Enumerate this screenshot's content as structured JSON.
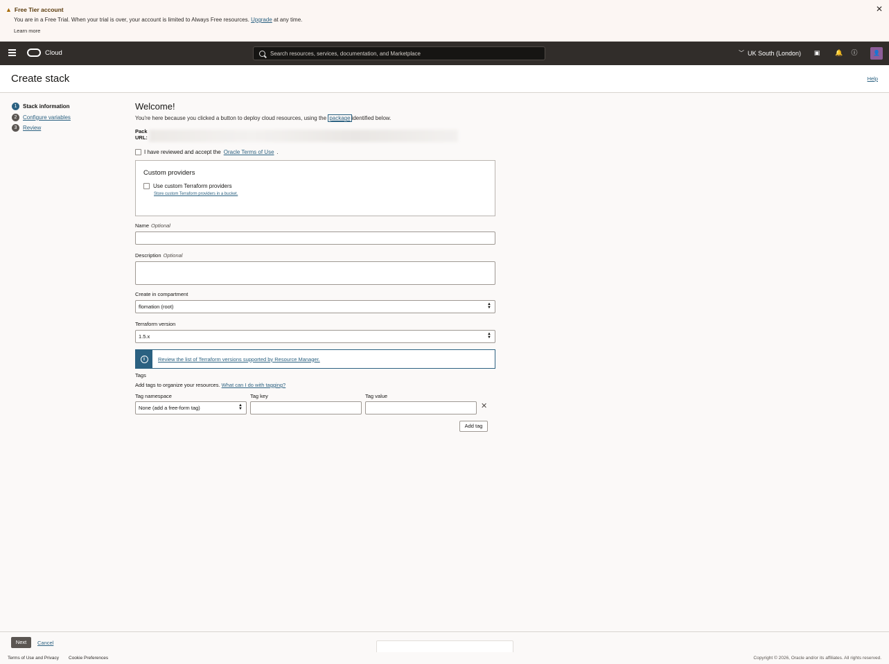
{
  "banner": {
    "title": "Free Tier account",
    "text_before": "You are in a Free Trial. When your trial is over, your account is limited to Always Free resources.",
    "upgrade_link": "Upgrade",
    "text_after": "at any time.",
    "learn_more": "Learn more"
  },
  "header": {
    "brand": "Cloud",
    "search_placeholder": "Search resources, services, documentation, and Marketplace",
    "region": "UK South (London)"
  },
  "page": {
    "title": "Create stack",
    "help": "Help"
  },
  "steps": [
    {
      "num": "1",
      "label": "Stack information"
    },
    {
      "num": "2",
      "label": "Configure variables"
    },
    {
      "num": "3",
      "label": "Review"
    }
  ],
  "form": {
    "welcome": "Welcome!",
    "intro_before": "You're here because you clicked a button to deploy cloud resources, using the",
    "intro_link": "package",
    "intro_after": "identified below.",
    "package_label_1": "Pack",
    "package_label_2": "URL:",
    "terms_before": "I have reviewed and accept the",
    "terms_link": "Oracle Terms of Use",
    "terms_after": ".",
    "custom_providers": {
      "title": "Custom providers",
      "checkbox_label": "Use custom Terraform providers",
      "link": "Store custom Terraform providers in a bucket."
    },
    "name_label": "Name",
    "name_optional": "Optional",
    "description_label": "Description",
    "description_optional": "Optional",
    "compartment_label": "Create in compartment",
    "compartment_value": "flomation (root)",
    "terraform_label": "Terraform version",
    "terraform_value": "1.5.x",
    "info_link": "Review the list of Terraform versions supported by Resource Manager.",
    "tags": {
      "title": "Tags",
      "desc": "Add tags to organize your resources.",
      "desc_link": "What can I do with tagging?",
      "namespace_label": "Tag namespace",
      "namespace_value": "None (add a free-form tag)",
      "key_label": "Tag key",
      "value_label": "Tag value",
      "add_tag": "Add tag"
    }
  },
  "footer": {
    "next": "Next",
    "cancel": "Cancel",
    "terms": "Terms of Use and Privacy",
    "cookies": "Cookie Preferences",
    "copyright": "Copyright © 2026, Oracle and/or its affiliates. All rights reserved."
  }
}
